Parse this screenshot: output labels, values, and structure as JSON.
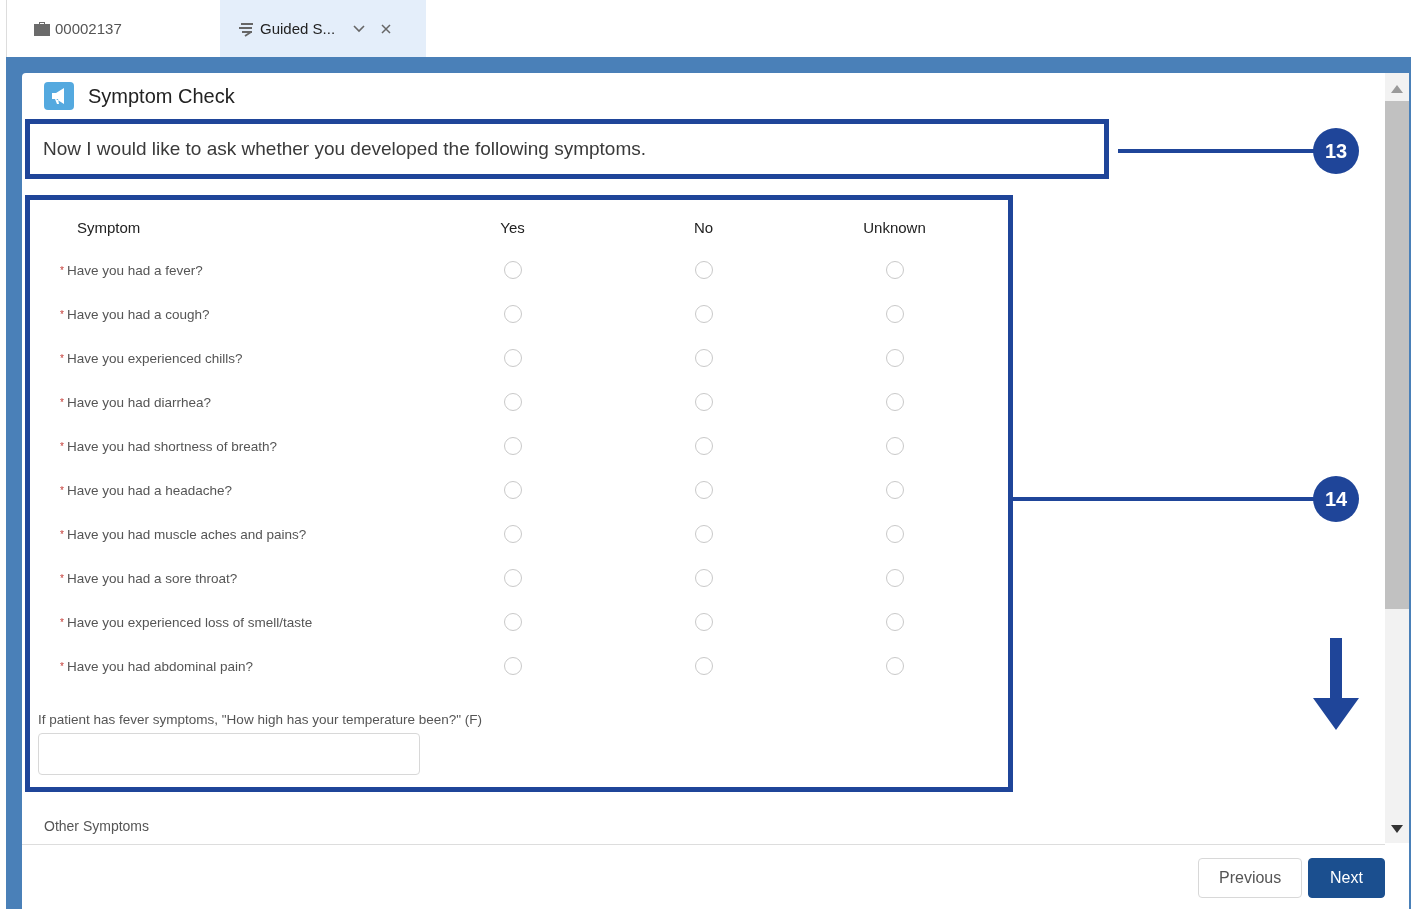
{
  "tabs": [
    {
      "label": "00002137",
      "kind": "record",
      "selected": false,
      "closable": false
    },
    {
      "label": "Guided S...",
      "kind": "flow",
      "selected": true,
      "closable": true,
      "menu": true
    }
  ],
  "panel": {
    "title": "Symptom Check",
    "intro": "Now I would like to ask whether you developed the following symptoms.",
    "columns": [
      "Symptom",
      "Yes",
      "No",
      "Unknown"
    ],
    "rows": [
      {
        "mark": "*",
        "question": "Have you had a fever?",
        "answers": [
          {
            "selected": false
          },
          {
            "selected": false
          },
          {
            "selected": false
          }
        ]
      },
      {
        "mark": "*",
        "question": "Have you had a cough?",
        "answers": [
          {
            "selected": false
          },
          {
            "selected": false
          },
          {
            "selected": false
          }
        ]
      },
      {
        "mark": "*",
        "question": "Have you experienced chills?",
        "answers": [
          {
            "selected": false
          },
          {
            "selected": false
          },
          {
            "selected": false
          }
        ]
      },
      {
        "mark": "*",
        "question": "Have you had diarrhea?",
        "answers": [
          {
            "selected": false
          },
          {
            "selected": false
          },
          {
            "selected": false
          }
        ]
      },
      {
        "mark": "*",
        "question": "Have you had shortness of breath?",
        "answers": [
          {
            "selected": false
          },
          {
            "selected": false
          },
          {
            "selected": false
          }
        ]
      },
      {
        "mark": "*",
        "question": "Have you had a headache?",
        "answers": [
          {
            "selected": false
          },
          {
            "selected": false
          },
          {
            "selected": false
          }
        ]
      },
      {
        "mark": "*",
        "question": "Have you had muscle aches and pains?",
        "answers": [
          {
            "selected": false
          },
          {
            "selected": false
          },
          {
            "selected": false
          }
        ]
      },
      {
        "mark": "*",
        "question": "Have you had a sore throat?",
        "answers": [
          {
            "selected": false
          },
          {
            "selected": false
          },
          {
            "selected": false
          }
        ]
      },
      {
        "mark": "*",
        "question": "Have you experienced loss of smell/taste",
        "answers": [
          {
            "selected": false
          },
          {
            "selected": false
          },
          {
            "selected": false
          }
        ]
      },
      {
        "mark": "*",
        "question": "Have you had abdominal pain?",
        "answers": [
          {
            "selected": false
          },
          {
            "selected": false
          },
          {
            "selected": false
          }
        ]
      }
    ],
    "temperature_label": "If patient has fever symptoms, \"How high has your temperature been?\" (F)",
    "next_section": "Other Symptoms",
    "buttons": [
      {
        "label": "Previous",
        "kind": "neutral"
      },
      {
        "label": "Next",
        "kind": "brand"
      }
    ]
  },
  "callouts": [
    "13",
    "14"
  ]
}
